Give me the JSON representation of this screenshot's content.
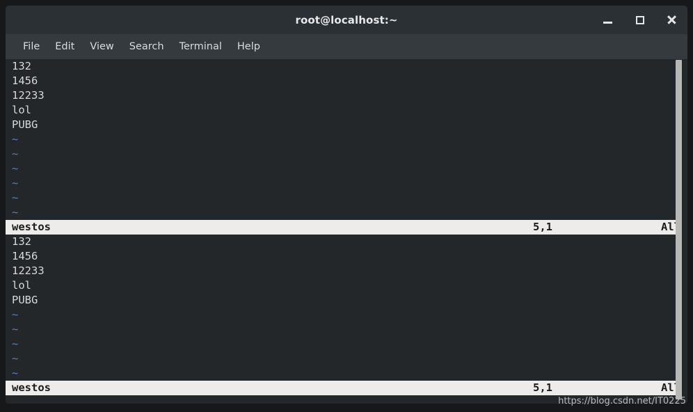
{
  "window": {
    "title": "root@localhost:~",
    "controls": [
      {
        "name": "minimize-button",
        "icon": "minimize-icon",
        "label": "_"
      },
      {
        "name": "maximize-button",
        "icon": "maximize-icon",
        "label": "□"
      },
      {
        "name": "close-button",
        "icon": "close-icon",
        "label": "×"
      }
    ]
  },
  "menubar": {
    "items": [
      {
        "label": "File"
      },
      {
        "label": "Edit"
      },
      {
        "label": "View"
      },
      {
        "label": "Search"
      },
      {
        "label": "Terminal"
      },
      {
        "label": "Help"
      }
    ]
  },
  "terminal": {
    "panes": [
      {
        "lines": [
          "132",
          "1456",
          "12233",
          "lol",
          "PUBG"
        ],
        "empty_markers": [
          "~",
          "~",
          "~",
          "~",
          "~",
          "~"
        ],
        "statusline": {
          "filename": "westos",
          "position": "5,1",
          "percent": "All"
        }
      },
      {
        "lines": [
          "132",
          "1456",
          "12233",
          "lol",
          "PUBG"
        ],
        "empty_markers": [
          "~",
          "~",
          "~",
          "~",
          "~"
        ],
        "statusline": {
          "filename": "westos",
          "position": "5,1",
          "percent": "All"
        }
      }
    ]
  },
  "watermark": {
    "text": "https://blog.csdn.net/IT0225"
  },
  "colors": {
    "titlebar_bg": "#2b3034",
    "menubar_bg": "#343a3d",
    "terminal_bg": "#232729",
    "terminal_fg": "#d6d8d9",
    "tilde_fg": "#5c7fae",
    "statusline_bg": "#edecea",
    "statusline_fg": "#1a1c1e",
    "scrollbar": "#b7b8b6"
  }
}
